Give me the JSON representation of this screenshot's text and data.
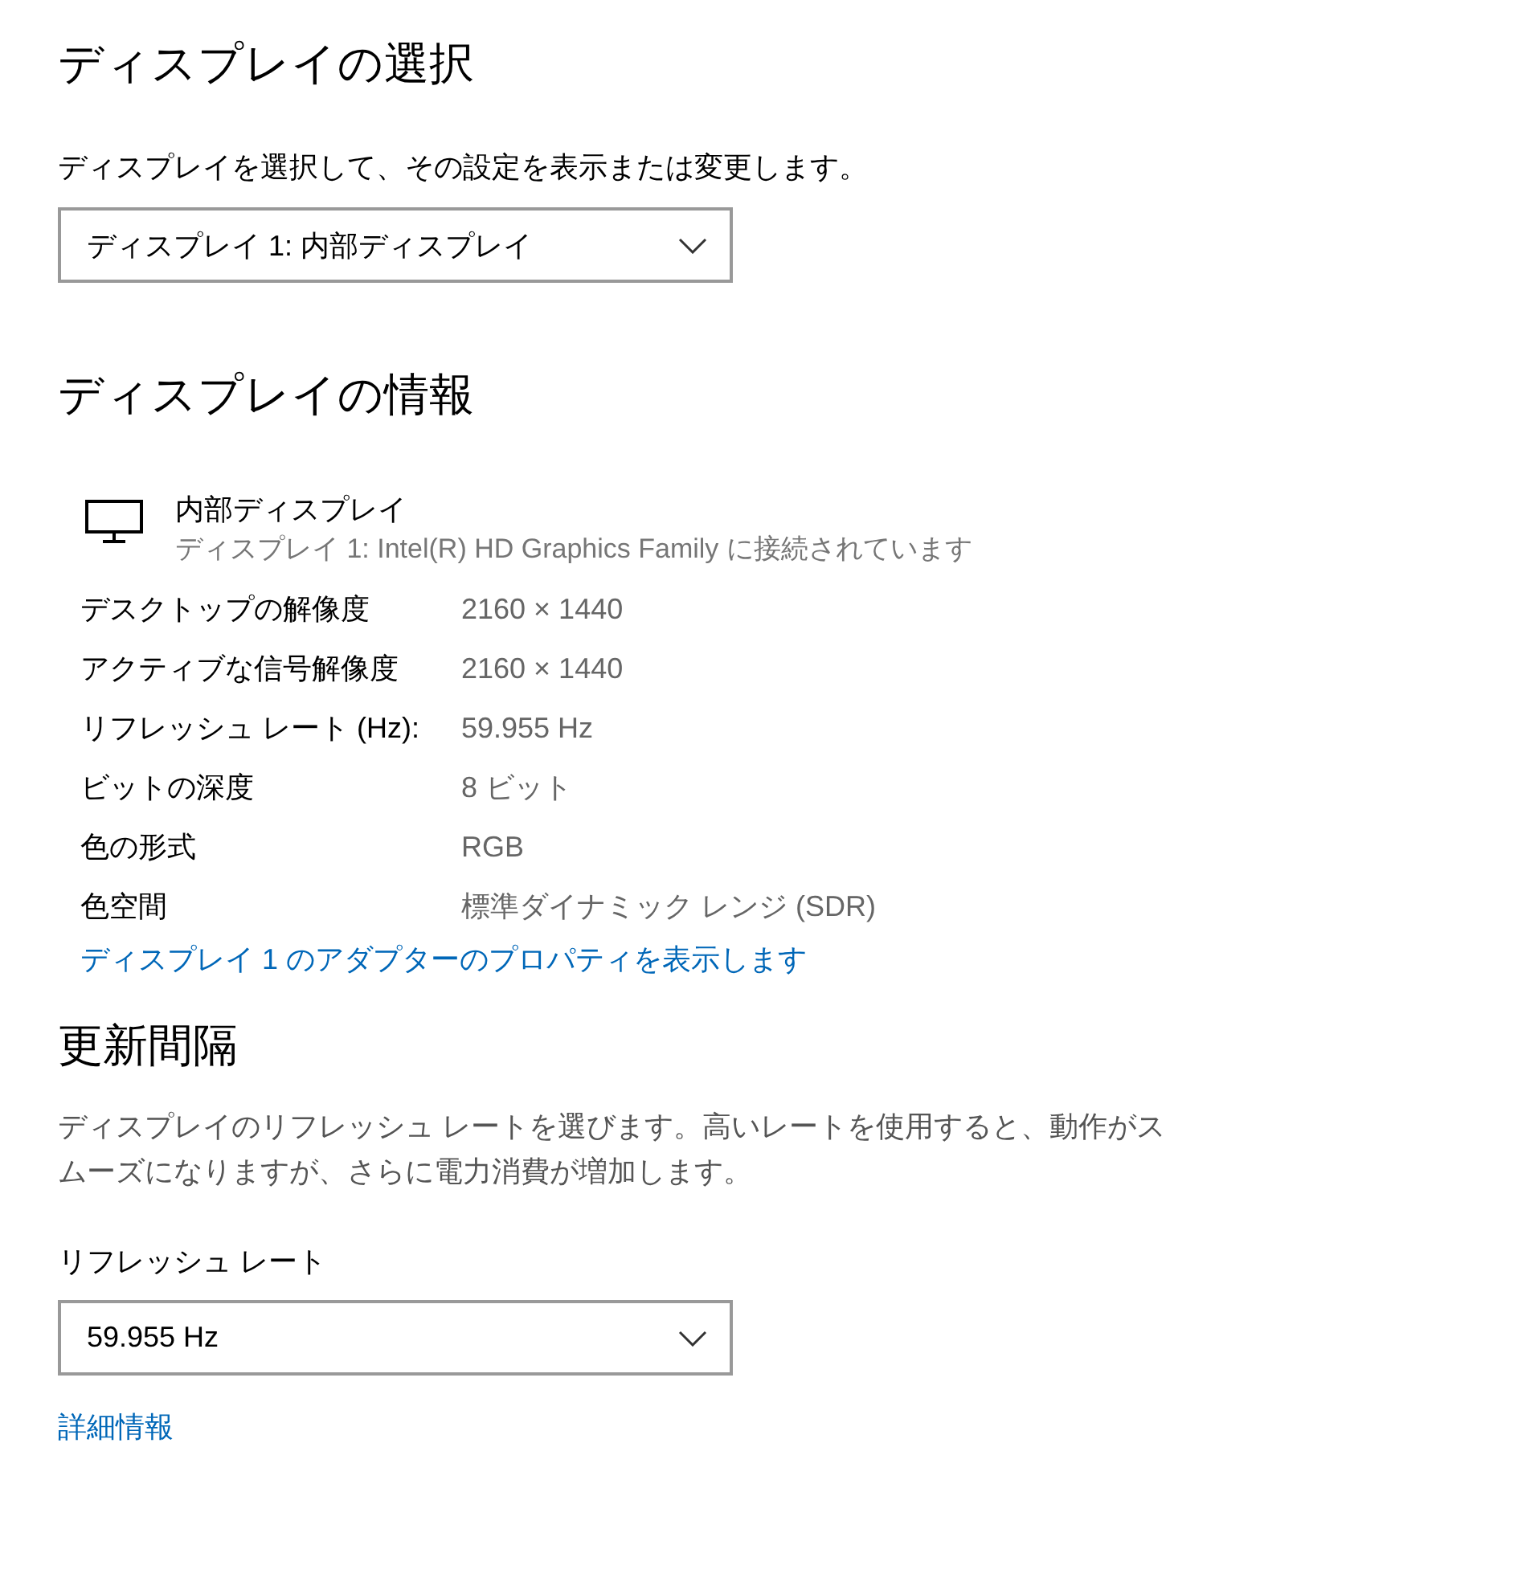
{
  "display_select": {
    "title": "ディスプレイの選択",
    "description": "ディスプレイを選択して、その設定を表示または変更します。",
    "dropdown": {
      "value": "ディスプレイ 1: 内部ディスプレイ"
    }
  },
  "display_info": {
    "title": "ディスプレイの情報",
    "monitor": {
      "name": "内部ディスプレイ",
      "detail": "ディスプレイ 1: Intel(R) HD Graphics Family に接続されています"
    },
    "rows": [
      {
        "label": "デスクトップの解像度",
        "value": "2160 × 1440"
      },
      {
        "label": "アクティブな信号解像度",
        "value": "2160 × 1440"
      },
      {
        "label": "リフレッシュ レート (Hz):",
        "value": "59.955 Hz"
      },
      {
        "label": "ビットの深度",
        "value": "8 ビット"
      },
      {
        "label": "色の形式",
        "value": "RGB"
      },
      {
        "label": "色空間",
        "value": "標準ダイナミック レンジ (SDR)"
      }
    ],
    "link": "ディスプレイ 1 のアダプターのプロパティを表示します"
  },
  "refresh": {
    "title": "更新間隔",
    "description": "ディスプレイのリフレッシュ レートを選びます。高いレートを使用すると、動作がスムーズになりますが、さらに電力消費が増加します。",
    "field_label": "リフレッシュ レート",
    "dropdown": {
      "value": "59.955 Hz"
    },
    "link": "詳細情報"
  }
}
